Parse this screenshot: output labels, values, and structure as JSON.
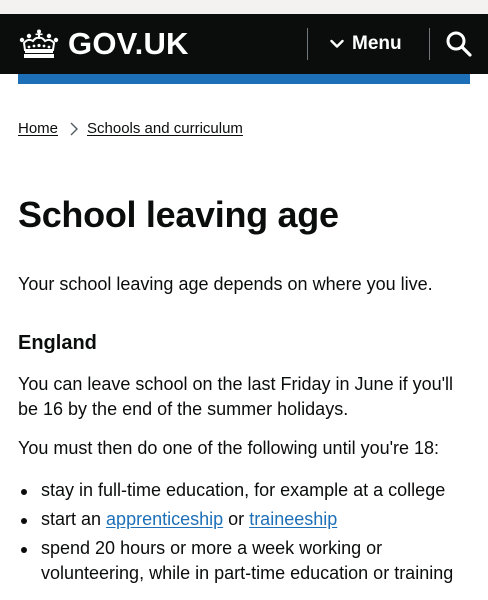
{
  "header": {
    "logo_text": "GOV.UK",
    "menu_label": "Menu",
    "search_icon": "search-icon",
    "menu_icon": "chevron-down-icon",
    "crown_icon": "crown-icon"
  },
  "colors": {
    "header_bg": "#0b0c0c",
    "accent_bar": "#1d70b8",
    "link": "#1d70b8",
    "text": "#0b0c0c"
  },
  "breadcrumb": {
    "items": [
      "Home",
      "Schools and curriculum"
    ]
  },
  "page": {
    "title": "School leaving age",
    "lead": "Your school leaving age depends on where you live.",
    "section_heading": "England",
    "para1": "You can leave school on the last Friday in June if you'll be 16 by the end of the summer holidays.",
    "para2": "You must then do one of the following until you're 18:"
  },
  "options": {
    "item1": "stay in full-time education, for example at a college",
    "item2_prefix": "start an",
    "item2_link1": "apprenticeship",
    "item2_middle": "or",
    "item2_link2": "traineeship",
    "item3": "spend 20 hours or more a week working or volunteering, while in part-time education or training"
  }
}
